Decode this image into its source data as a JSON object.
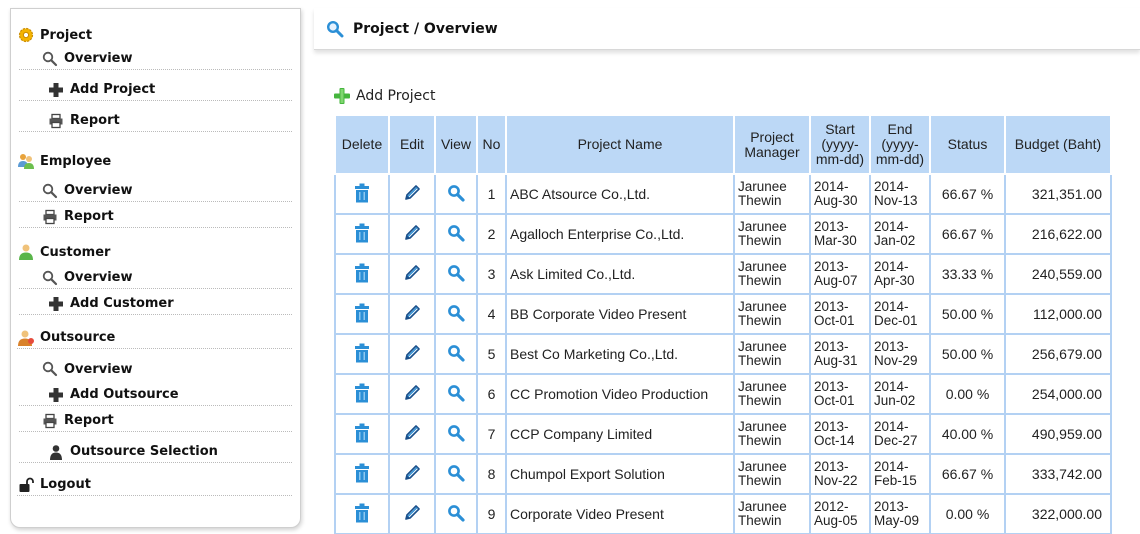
{
  "sidebar": {
    "project": {
      "heading": "Project",
      "items": [
        {
          "label": "Overview",
          "icon": "magnifier-icon"
        },
        {
          "label": "Add Project",
          "icon": "plus-icon"
        },
        {
          "label": "Report",
          "icon": "printer-icon"
        }
      ]
    },
    "employee": {
      "heading": "Employee",
      "items": [
        {
          "label": "Overview",
          "icon": "magnifier-icon"
        },
        {
          "label": "Report",
          "icon": "printer-icon"
        }
      ]
    },
    "customer": {
      "heading": "Customer",
      "items": [
        {
          "label": "Overview",
          "icon": "magnifier-icon"
        },
        {
          "label": "Add Customer",
          "icon": "plus-icon"
        }
      ]
    },
    "outsource": {
      "heading": "Outsource",
      "items": [
        {
          "label": "Overview",
          "icon": "magnifier-icon"
        },
        {
          "label": "Add Outsource",
          "icon": "plus-icon"
        },
        {
          "label": "Report",
          "icon": "printer-icon"
        },
        {
          "label": "Outsource Selection",
          "icon": "person-icon"
        }
      ]
    },
    "logout": "Logout"
  },
  "header": {
    "title": "Project / Overview"
  },
  "toolbar": {
    "add_project": "Add Project"
  },
  "table": {
    "headers": {
      "delete": "Delete",
      "edit": "Edit",
      "view": "View",
      "no": "No",
      "name": "Project Name",
      "manager_1": "Project",
      "manager_2": "Manager",
      "start_1": "Start",
      "start_2": "(yyyy-",
      "start_3": "mm-dd)",
      "end_1": "End",
      "end_2": "(yyyy-",
      "end_3": "mm-dd)",
      "status": "Status",
      "budget": "Budget (Baht)"
    },
    "rows": [
      {
        "no": "1",
        "name": "ABC Atsource Co.,Ltd.",
        "mgr1": "Jarunee",
        "mgr2": "Thewin",
        "s1": "2014-",
        "s2": "Aug-30",
        "e1": "2014-",
        "e2": "Nov-13",
        "status": "66.67 %",
        "budget": "321,351.00"
      },
      {
        "no": "2",
        "name": "Agalloch Enterprise Co.,Ltd.",
        "mgr1": "Jarunee",
        "mgr2": "Thewin",
        "s1": "2013-",
        "s2": "Mar-30",
        "e1": "2014-",
        "e2": "Jan-02",
        "status": "66.67 %",
        "budget": "216,622.00"
      },
      {
        "no": "3",
        "name": "Ask Limited Co.,Ltd.",
        "mgr1": "Jarunee",
        "mgr2": "Thewin",
        "s1": "2013-",
        "s2": "Aug-07",
        "e1": "2014-",
        "e2": "Apr-30",
        "status": "33.33 %",
        "budget": "240,559.00"
      },
      {
        "no": "4",
        "name": "BB Corporate Video Present",
        "mgr1": "Jarunee",
        "mgr2": "Thewin",
        "s1": "2013-",
        "s2": "Oct-01",
        "e1": "2014-",
        "e2": "Dec-01",
        "status": "50.00 %",
        "budget": "112,000.00"
      },
      {
        "no": "5",
        "name": "Best Co Marketing Co.,Ltd.",
        "mgr1": "Jarunee",
        "mgr2": "Thewin",
        "s1": "2013-",
        "s2": "Aug-31",
        "e1": "2013-",
        "e2": "Nov-29",
        "status": "50.00 %",
        "budget": "256,679.00"
      },
      {
        "no": "6",
        "name": "CC Promotion Video Production",
        "mgr1": "Jarunee",
        "mgr2": "Thewin",
        "s1": "2013-",
        "s2": "Oct-01",
        "e1": "2014-",
        "e2": "Jun-02",
        "status": "0.00 %",
        "budget": "254,000.00"
      },
      {
        "no": "7",
        "name": "CCP Company Limited",
        "mgr1": "Jarunee",
        "mgr2": "Thewin",
        "s1": "2013-",
        "s2": "Oct-14",
        "e1": "2014-",
        "e2": "Dec-27",
        "status": "40.00 %",
        "budget": "490,959.00"
      },
      {
        "no": "8",
        "name": "Chumpol Export Solution",
        "mgr1": "Jarunee",
        "mgr2": "Thewin",
        "s1": "2013-",
        "s2": "Nov-22",
        "e1": "2014-",
        "e2": "Feb-15",
        "status": "66.67 %",
        "budget": "333,742.00"
      },
      {
        "no": "9",
        "name": "Corporate Video Present",
        "mgr1": "Jarunee",
        "mgr2": "Thewin",
        "s1": "2012-",
        "s2": "Aug-05",
        "e1": "2013-",
        "e2": "May-09",
        "status": "0.00 %",
        "budget": "322,000.00"
      }
    ]
  },
  "colors": {
    "header_bg": "#bcd8f6",
    "cell_border": "#b3d1f3",
    "icon_blue": "#2b8fd6",
    "plus_green": "#45b53d"
  }
}
